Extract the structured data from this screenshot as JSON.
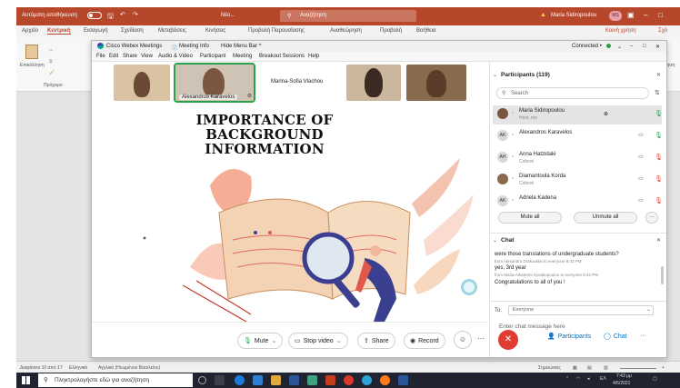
{
  "ppt": {
    "autosave": "Αυτόματη αποθήκευση",
    "file_name": "Νέο...",
    "search": "Αναζήτηση",
    "user": "Maria Sidiropoulou",
    "user_initials": "MS",
    "tabs": [
      "Αρχείο",
      "Κεντρική",
      "Εισαγωγή",
      "Σχεδίαση",
      "Μεταβάσεις",
      "Κινήσεις",
      "Προβολή Παρουσίασης",
      "Αναθεώρηση",
      "Προβολή",
      "Βοήθεια"
    ],
    "active_tab_index": 1,
    "share_label": "Κοινή χρήση",
    "comments_label": "Σχό",
    "ribbon_labels": [
      "Επικόλληση",
      "Πρόχειρο",
      "Αναζήτηση"
    ],
    "status_slide": "Διαφάνεια 10 από 17",
    "status_lang": "Ελληνικά",
    "status_access": "Αγγλικά (Ηνωμένου Βασιλείου)",
    "status_notes": "Σημειώσεις",
    "zoom_plus": "+"
  },
  "webex": {
    "title": "Cisco Webex Meetings",
    "meeting_info": "Meeting Info",
    "hide_menu": "Hide Menu Bar ^",
    "connected": "Connected •",
    "window_controls": [
      "–",
      "□",
      "✕"
    ],
    "menu": [
      "File",
      "Edit",
      "Share",
      "View",
      "Audio & Video",
      "Participant",
      "Meeting",
      "Breakout Sessions",
      "Help"
    ]
  },
  "videos": [
    {
      "name": ""
    },
    {
      "name": "Alexandros Karavelos"
    },
    {
      "name": "Marina-Sofia Vlachou"
    },
    {
      "name": ""
    },
    {
      "name": ""
    }
  ],
  "slide": {
    "title_line1": "IMPORTANCE OF BACKGROUND",
    "title_line2": "INFORMATION"
  },
  "controls": {
    "mute": "Mute",
    "stop_video": "Stop video",
    "share": "Share",
    "record": "Record",
    "participants": "Participants",
    "chat": "Chat",
    "more": "···"
  },
  "participants": {
    "header": "Participants (119)",
    "search_placeholder": "Search",
    "list": [
      {
        "initials": "",
        "name": "Maria Sidiropoulou",
        "sub": "Host, me",
        "mic": "on"
      },
      {
        "initials": "AK",
        "name": "Alexandros Karavelos",
        "sub": "",
        "mic": "on"
      },
      {
        "initials": "AH",
        "name": "Anna Hatzidaki",
        "sub": "Cohost",
        "mic": "off"
      },
      {
        "initials": "",
        "name": "Diamantoula Korda",
        "sub": "Cohost",
        "mic": "off"
      },
      {
        "initials": "AK",
        "name": "Adriela Kadena",
        "sub": "",
        "mic": "off"
      }
    ],
    "mute_all": "Mute all",
    "unmute_all": "Unmute all"
  },
  "chat": {
    "header": "Chat",
    "messages": [
      {
        "text": "were those translations of undergraduate students?",
        "meta": "from Alexandra Drakoulaki to everyone   8:42 PM"
      },
      {
        "text": "yes, 3rd year",
        "meta": "from Maria-Aikaterini Kyriakopoulou to everyone   8:42 PM"
      },
      {
        "text": "Congratulations to all of you !",
        "meta": ""
      }
    ],
    "to_label": "To:",
    "to_value": "Everyone",
    "input_placeholder": "Enter chat message here"
  },
  "taskbar": {
    "search_placeholder": "Πληκτρολογήστε εδώ για αναζήτηση",
    "time": "7:43 μμ",
    "date": "4/6/2021",
    "lang": "ΕΛ"
  },
  "colors": {
    "ppt_red": "#b7472a",
    "webex_green": "#29a34a",
    "end_red": "#e03c31",
    "link_blue": "#0070c0"
  }
}
